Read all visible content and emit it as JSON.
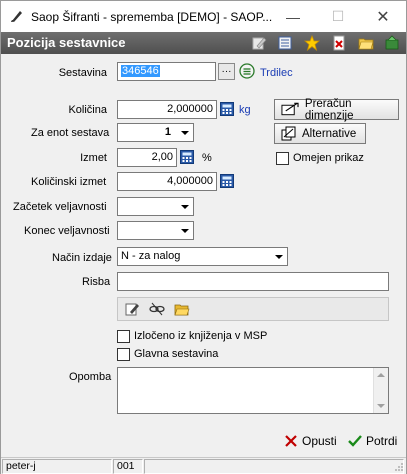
{
  "window": {
    "title": "Saop Šifranti - sprememba [DEMO] - SAOP...",
    "minimize_glyph": "—",
    "maximize_glyph": "☐",
    "close_glyph": "✕"
  },
  "header": {
    "title": "Pozicija sestavnice",
    "icons": [
      "edit-icon",
      "list-icon",
      "star-icon",
      "delete-icon",
      "folder-icon",
      "export-icon"
    ]
  },
  "form": {
    "sestavina_label": "Sestavina",
    "sestavina_value": "346546",
    "sestavina_name": "Trdilec",
    "kolicina_label": "Količina",
    "kolicina_value": "2,000000",
    "kolicina_unit": "kg",
    "za_enot_label": "Za enot sestava",
    "za_enot_value": "1",
    "izmet_label": "Izmet",
    "izmet_value": "2,00",
    "izmet_unit": "%",
    "kolicinski_izmet_label": "Količinski izmet",
    "kolicinski_izmet_value": "4,000000",
    "zacetek_label": "Začetek veljavnosti",
    "zacetek_value": "",
    "konec_label": "Konec veljavnosti",
    "konec_value": "",
    "nacin_label": "Način izdaje",
    "nacin_value": "N - za nalog",
    "risba_label": "Risba",
    "risba_value": "",
    "izloceno_label": "Izločeno iz knjiženja v MSP",
    "izloceno_checked": false,
    "glavna_label": "Glavna sestavina",
    "glavna_checked": false,
    "opomba_label": "Opomba",
    "opomba_value": "",
    "ellipsis": "···"
  },
  "actions": {
    "preracun_label": "Preračun dimenzije",
    "alternative_label": "Alternative",
    "omejen_label": "Omejen prikaz",
    "omejen_checked": false
  },
  "footer": {
    "cancel_label": "Opusti",
    "confirm_label": "Potrdi"
  },
  "status": {
    "user": "peter-j",
    "code": "001"
  },
  "colors": {
    "header_bg": "#5a5a5a",
    "selection": "#3399ff",
    "link": "#1a3cb4",
    "cancel_red": "#c00000",
    "confirm_green": "#1a8a1a"
  }
}
